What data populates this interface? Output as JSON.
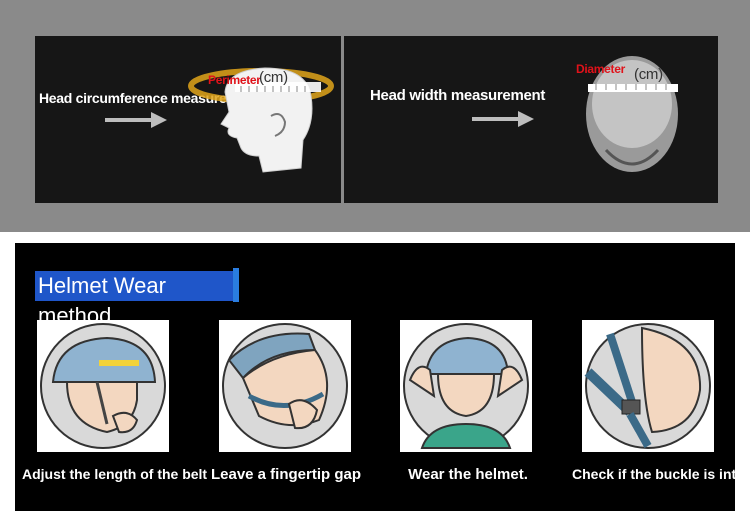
{
  "measurements": {
    "head_circumference": {
      "label": "Head circumference measurement",
      "tape_label": "Perimeter",
      "unit": "(cm)"
    },
    "head_width": {
      "label": "Head width measurement",
      "tape_label": "Diameter",
      "unit": "(cm)"
    }
  },
  "wear_method": {
    "title": "Helmet Wear method",
    "steps": [
      {
        "caption": "Adjust the length of the belt"
      },
      {
        "caption": "Leave a fingertip gap"
      },
      {
        "caption": "Wear the helmet."
      },
      {
        "caption": "Check if the buckle is intact"
      }
    ]
  },
  "colors": {
    "panel_bg": "#161616",
    "title_bg": "#1f56c9",
    "tape_label": "#e0121a",
    "ring": "#e0a51a"
  }
}
